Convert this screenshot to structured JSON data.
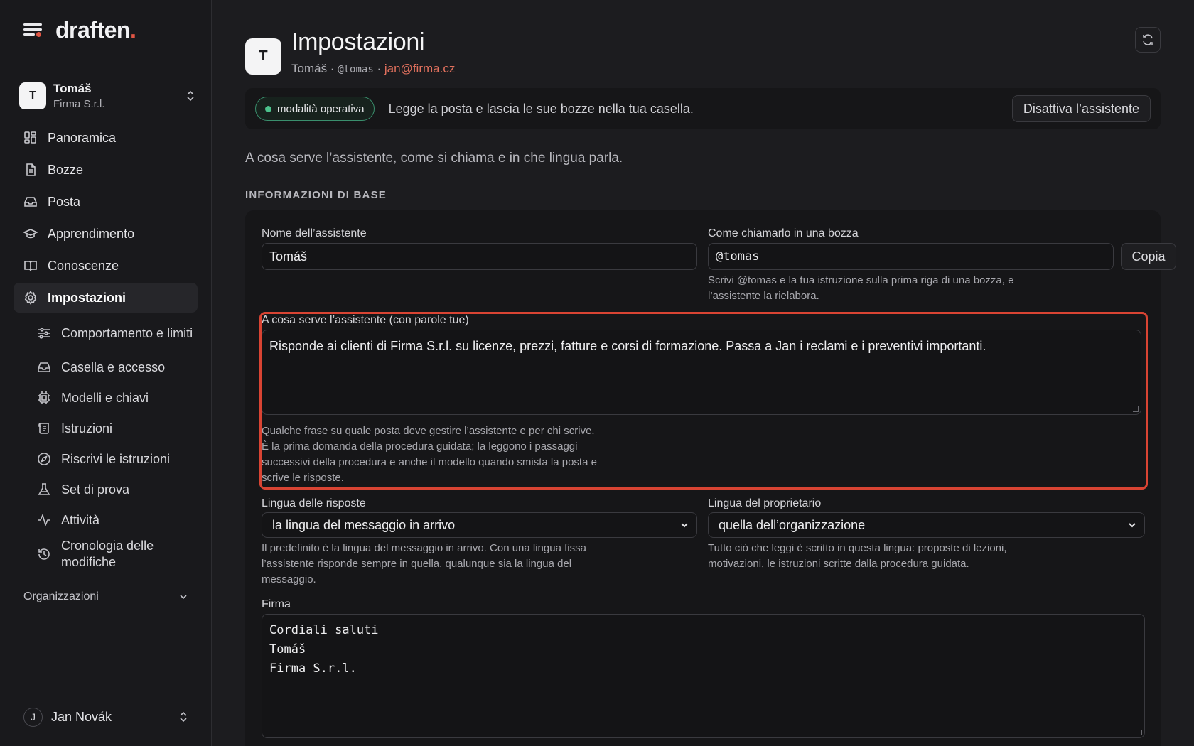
{
  "brand": {
    "name": "draften",
    "dot": "."
  },
  "account": {
    "initial": "T",
    "name": "Tomáš",
    "org": "Firma S.r.l."
  },
  "nav": [
    {
      "label": "Panoramica",
      "icon": "dashboard-icon"
    },
    {
      "label": "Bozze",
      "icon": "document-icon"
    },
    {
      "label": "Posta",
      "icon": "inbox-icon"
    },
    {
      "label": "Apprendimento",
      "icon": "graduation-cap-icon"
    },
    {
      "label": "Conoscenze",
      "icon": "book-icon"
    },
    {
      "label": "Impostazioni",
      "icon": "gear-icon",
      "active": true
    }
  ],
  "subnav": [
    {
      "label": "Comportamento e limiti",
      "icon": "sliders-icon"
    },
    {
      "label": "Casella e accesso",
      "icon": "inbox-icon"
    },
    {
      "label": "Modelli e chiavi",
      "icon": "chip-icon"
    },
    {
      "label": "Istruzioni",
      "icon": "scroll-icon"
    },
    {
      "label": "Riscrivi le istruzioni",
      "icon": "compass-icon"
    },
    {
      "label": "Set di prova",
      "icon": "flask-icon"
    },
    {
      "label": "Attività",
      "icon": "activity-icon"
    },
    {
      "label": "Cronologia delle modifiche",
      "icon": "history-icon"
    }
  ],
  "organizations_label": "Organizzazioni",
  "user": {
    "initial": "J",
    "name": "Jan Novák"
  },
  "header": {
    "initial": "T",
    "title": "Impostazioni",
    "name": "Tomáš",
    "sep1": " · ",
    "handle": "@tomas",
    "sep2": " · ",
    "email": "jan@firma.cz"
  },
  "banner": {
    "status": "modalità operativa",
    "description": "Legge la posta e lascia le sue bozze nella tua casella.",
    "deactivate_label": "Disattiva l’assistente"
  },
  "lead": "A cosa serve l’assistente, come si chiama e in che lingua parla.",
  "section_title": "INFORMAZIONI DI BASE",
  "form": {
    "name_label": "Nome dell’assistente",
    "name_value": "Tomáš",
    "call_label": "Come chiamarlo in una bozza",
    "call_value": "@tomas",
    "copy_label": "Copia",
    "call_help_1": "Scrivi @tomas e la tua istruzione sulla prima riga di una bozza, e",
    "call_help_2": "l’assistente la rielabora.",
    "purpose_label": "A cosa serve l’assistente (con parole tue)",
    "purpose_value": "Risponde ai clienti di Firma S.r.l. su licenze, prezzi, fatture e corsi di formazione. Passa a Jan i reclami e i preventivi importanti.",
    "purpose_help_1": "Qualche frase su quale posta deve gestire l’assistente e per chi scrive.",
    "purpose_help_2": "È la prima domanda della procedura guidata; la leggono i passaggi",
    "purpose_help_3": "successivi della procedura e anche il modello quando smista la posta e",
    "purpose_help_4": "scrive le risposte.",
    "reply_lang_label": "Lingua delle risposte",
    "reply_lang_value": "la lingua del messaggio in arrivo",
    "reply_lang_help_1": "Il predefinito è la lingua del messaggio in arrivo. Con una lingua fissa",
    "reply_lang_help_2": "l’assistente risponde sempre in quella, qualunque sia la lingua del",
    "reply_lang_help_3": "messaggio.",
    "owner_lang_label": "Lingua del proprietario",
    "owner_lang_value": "quella dell’organizzazione",
    "owner_lang_help_1": "Tutto ciò che leggi è scritto in questa lingua: proposte di lezioni,",
    "owner_lang_help_2": "motivazioni, le istruzioni scritte dalla procedura guidata.",
    "signature_label": "Firma",
    "signature_value": "Cordiali saluti\nTomáš\nFirma S.r.l."
  },
  "colors": {
    "accent": "#e05544",
    "highlight": "#d94433",
    "status_green": "#4cc28c"
  }
}
